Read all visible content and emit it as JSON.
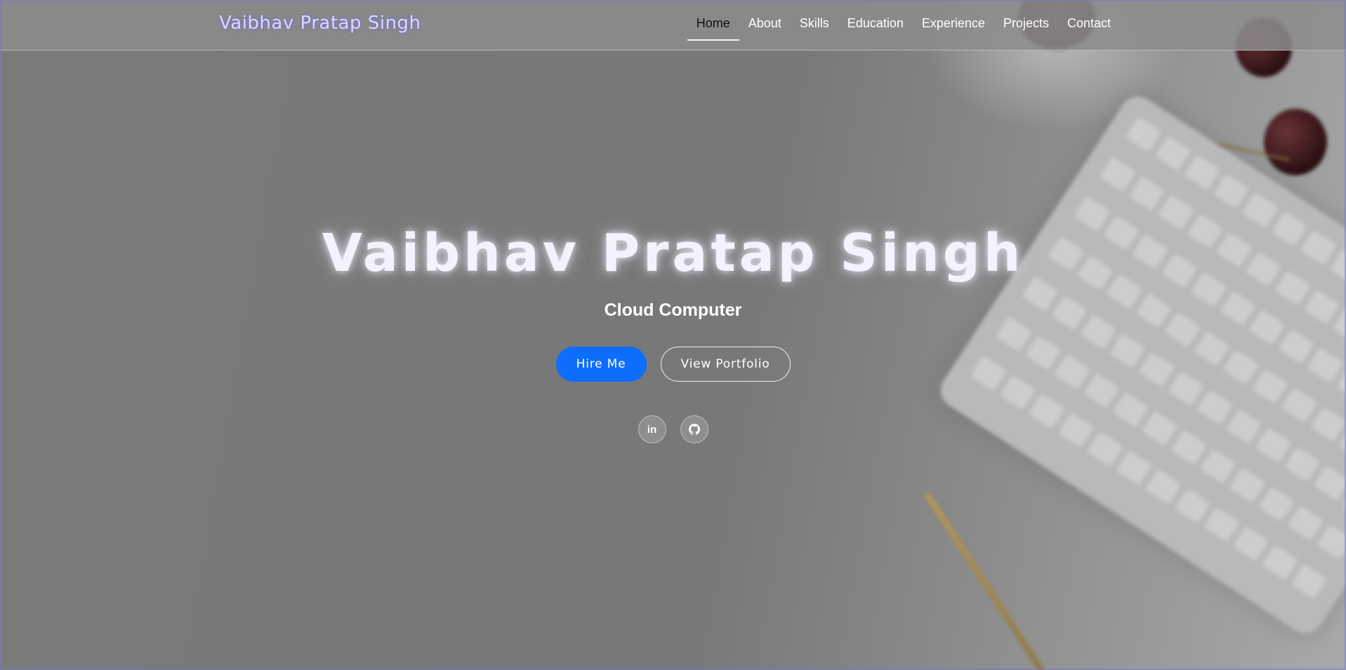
{
  "header": {
    "brand": "Vaibhav Pratap Singh",
    "nav": [
      {
        "label": "Home",
        "active": true
      },
      {
        "label": "About",
        "active": false
      },
      {
        "label": "Skills",
        "active": false
      },
      {
        "label": "Education",
        "active": false
      },
      {
        "label": "Experience",
        "active": false
      },
      {
        "label": "Projects",
        "active": false
      },
      {
        "label": "Contact",
        "active": false
      }
    ]
  },
  "hero": {
    "title": "Vaibhav Pratap Singh",
    "subtitle": "Cloud Computer",
    "buttons": {
      "primary": "Hire Me",
      "secondary": "View Portfolio"
    },
    "social": [
      {
        "icon": "linkedin-icon",
        "glyph": "in"
      },
      {
        "icon": "github-icon"
      }
    ]
  },
  "colors": {
    "primary_button": "#0d6efd",
    "brand_text": "#dcd9ff",
    "nav_bar": "#8c8c8c"
  }
}
